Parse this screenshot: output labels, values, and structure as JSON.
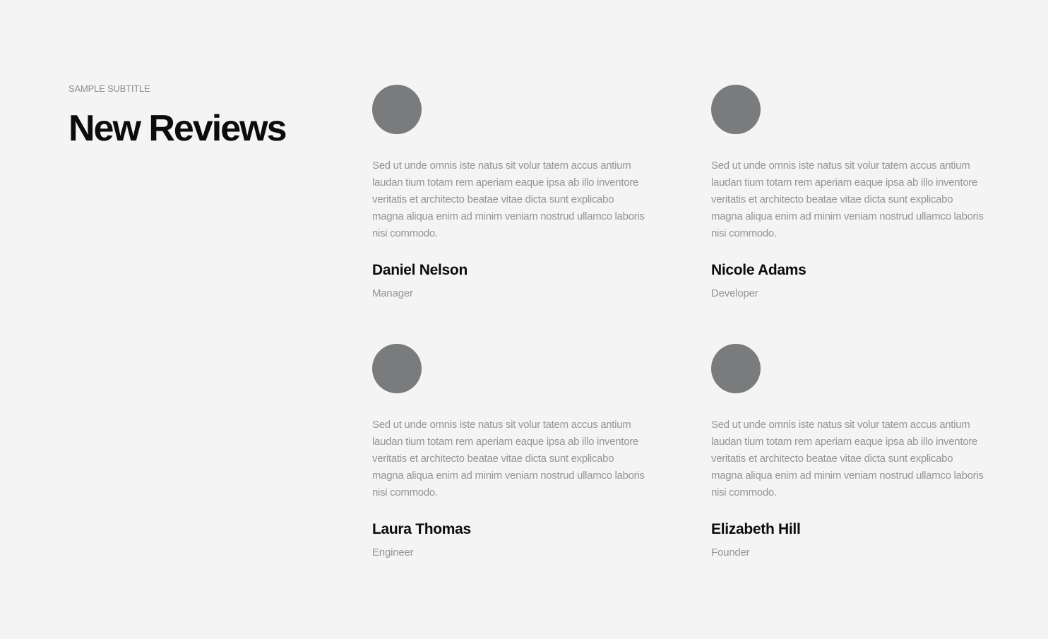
{
  "header": {
    "subtitle": "SAMPLE SUBTITLE",
    "title": "New Reviews"
  },
  "colors": {
    "background": "#f4f4f4",
    "avatar": "#7a7b7c",
    "heading": "#0c0c0c",
    "muted": "#959595"
  },
  "reviews": [
    {
      "text": "Sed ut unde omnis iste natus sit volur tatem accus antium laudan tium totam rem aperiam eaque ipsa ab illo inventore veritatis et architecto beatae vitae dicta sunt explicabo magna aliqua enim ad minim veniam nostrud ullamco laboris nisi commodo.",
      "name": "Daniel Nelson",
      "role": "Manager"
    },
    {
      "text": "Sed ut unde omnis iste natus sit volur tatem accus antium laudan tium totam rem aperiam eaque ipsa ab illo inventore veritatis et architecto beatae vitae dicta sunt explicabo magna aliqua enim ad minim veniam nostrud ullamco laboris nisi commodo.",
      "name": "Nicole Adams",
      "role": "Developer"
    },
    {
      "text": "Sed ut unde omnis iste natus sit volur tatem accus antium laudan tium totam rem aperiam eaque ipsa ab illo inventore veritatis et architecto beatae vitae dicta sunt explicabo magna aliqua enim ad minim veniam nostrud ullamco laboris nisi commodo.",
      "name": "Laura Thomas",
      "role": "Engineer"
    },
    {
      "text": "Sed ut unde omnis iste natus sit volur tatem accus antium laudan tium totam rem aperiam eaque ipsa ab illo inventore veritatis et architecto beatae vitae dicta sunt explicabo magna aliqua enim ad minim veniam nostrud ullamco laboris nisi commodo.",
      "name": "Elizabeth Hill",
      "role": "Founder"
    }
  ]
}
